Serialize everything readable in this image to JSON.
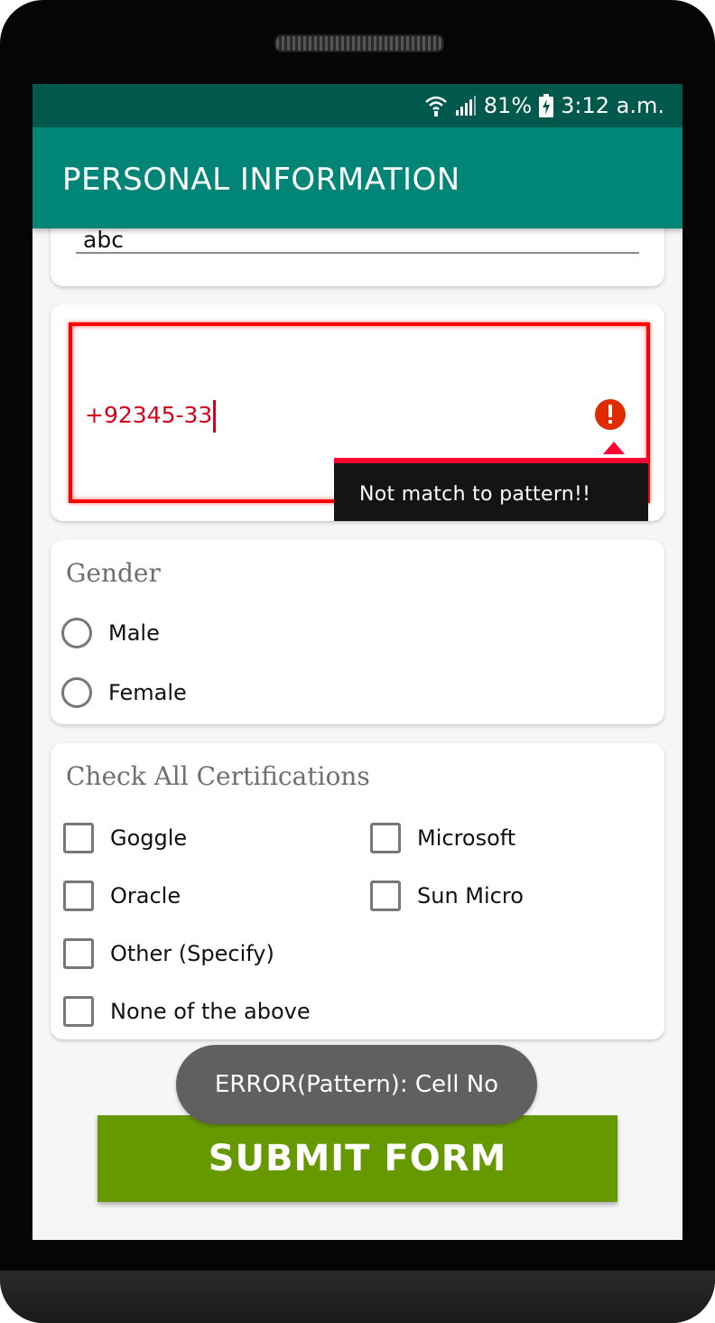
{
  "status_bar": {
    "battery_percent": "81%",
    "time": "3:12 a.m.",
    "icons": [
      "wifi-icon",
      "signal-icon",
      "battery-charging-icon"
    ]
  },
  "app_bar": {
    "title": "PERSONAL INFORMATION"
  },
  "name_field": {
    "value": "abc"
  },
  "cell_field": {
    "value": "+92345-33",
    "error_message": "Not match to pattern!!",
    "error_icon": "error-icon"
  },
  "gender": {
    "title": "Gender",
    "options": [
      {
        "label": "Male",
        "selected": false
      },
      {
        "label": "Female",
        "selected": false
      }
    ]
  },
  "certifications": {
    "title": "Check All Certifications",
    "options": [
      {
        "label": "Goggle",
        "checked": false
      },
      {
        "label": "Microsoft",
        "checked": false
      },
      {
        "label": "Oracle",
        "checked": false
      },
      {
        "label": "Sun Micro",
        "checked": false
      },
      {
        "label": "Other (Specify)",
        "checked": false
      },
      {
        "label": "None of the above",
        "checked": false
      }
    ]
  },
  "toast": {
    "text": "ERROR(Pattern): Cell No"
  },
  "submit": {
    "label": "SUBMIT FORM"
  },
  "colors": {
    "status_bar": "#00594c",
    "app_bar": "#008577",
    "error_red": "#ff0000",
    "submit_green": "#669900",
    "toast_gray": "#606060"
  }
}
